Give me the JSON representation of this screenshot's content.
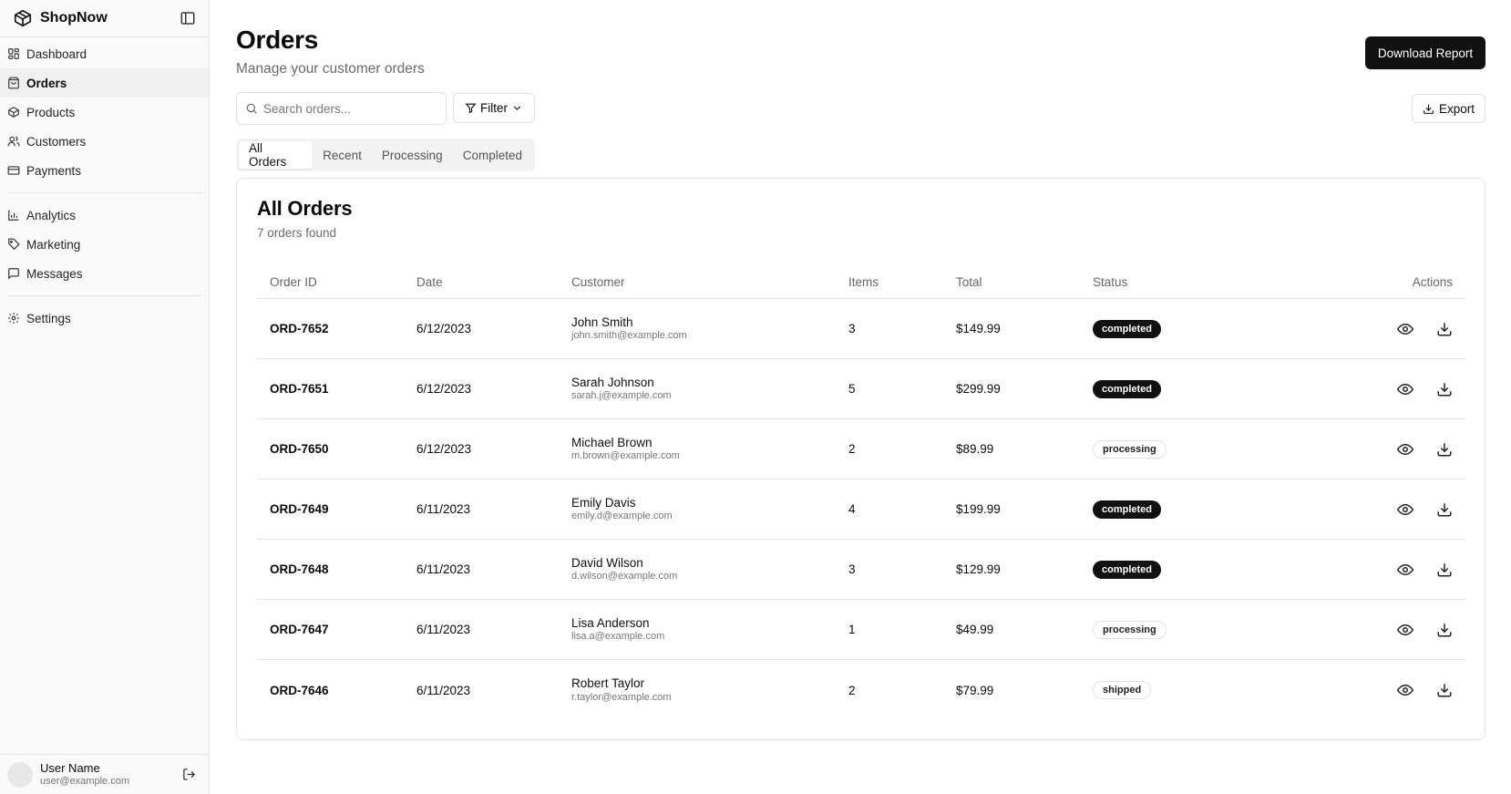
{
  "app": {
    "name": "ShopNow"
  },
  "sidebar": {
    "items": [
      {
        "label": "Dashboard",
        "icon": "dashboard-icon"
      },
      {
        "label": "Orders",
        "icon": "orders-icon",
        "active": true
      },
      {
        "label": "Products",
        "icon": "package-icon"
      },
      {
        "label": "Customers",
        "icon": "users-icon"
      },
      {
        "label": "Payments",
        "icon": "credit-card-icon"
      },
      {
        "label": "Analytics",
        "icon": "bar-chart-icon"
      },
      {
        "label": "Marketing",
        "icon": "tag-icon"
      },
      {
        "label": "Messages",
        "icon": "message-icon"
      },
      {
        "label": "Settings",
        "icon": "gear-icon"
      }
    ]
  },
  "user": {
    "name": "User Name",
    "email": "user@example.com"
  },
  "header": {
    "title": "Orders",
    "subtitle": "Manage your customer orders",
    "download_label": "Download Report"
  },
  "toolbar": {
    "search_placeholder": "Search orders...",
    "search_value": "",
    "filter_label": "Filter",
    "export_label": "Export"
  },
  "tabs": [
    {
      "label": "All Orders",
      "active": true
    },
    {
      "label": "Recent"
    },
    {
      "label": "Processing"
    },
    {
      "label": "Completed"
    }
  ],
  "card": {
    "title": "All Orders",
    "count_text": "7 orders found"
  },
  "table": {
    "columns": [
      "Order ID",
      "Date",
      "Customer",
      "Items",
      "Total",
      "Status",
      "Actions"
    ],
    "rows": [
      {
        "id": "ORD-7652",
        "date": "6/12/2023",
        "name": "John Smith",
        "email": "john.smith@example.com",
        "items": "3",
        "total": "$149.99",
        "status": "completed"
      },
      {
        "id": "ORD-7651",
        "date": "6/12/2023",
        "name": "Sarah Johnson",
        "email": "sarah.j@example.com",
        "items": "5",
        "total": "$299.99",
        "status": "completed"
      },
      {
        "id": "ORD-7650",
        "date": "6/12/2023",
        "name": "Michael Brown",
        "email": "m.brown@example.com",
        "items": "2",
        "total": "$89.99",
        "status": "processing"
      },
      {
        "id": "ORD-7649",
        "date": "6/11/2023",
        "name": "Emily Davis",
        "email": "emily.d@example.com",
        "items": "4",
        "total": "$199.99",
        "status": "completed"
      },
      {
        "id": "ORD-7648",
        "date": "6/11/2023",
        "name": "David Wilson",
        "email": "d.wilson@example.com",
        "items": "3",
        "total": "$129.99",
        "status": "completed"
      },
      {
        "id": "ORD-7647",
        "date": "6/11/2023",
        "name": "Lisa Anderson",
        "email": "lisa.a@example.com",
        "items": "1",
        "total": "$49.99",
        "status": "processing"
      },
      {
        "id": "ORD-7646",
        "date": "6/11/2023",
        "name": "Robert Taylor",
        "email": "r.taylor@example.com",
        "items": "2",
        "total": "$79.99",
        "status": "shipped"
      }
    ]
  },
  "colors": {
    "primary": "#111111",
    "border": "#e5e5e5",
    "muted": "#6b6b6b",
    "sidebar_bg": "#fafafa"
  }
}
